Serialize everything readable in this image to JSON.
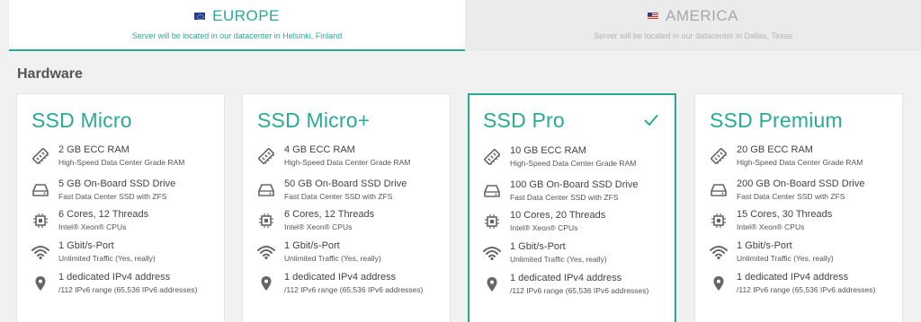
{
  "tabs": [
    {
      "region": "EUROPE",
      "subtitle": "Server will be located in our datacenter in Helsinki, Finland",
      "flag": "eu-flag-icon",
      "active": true
    },
    {
      "region": "AMERICA",
      "subtitle": "Server will be located in our datacenter in Dallas, Texas",
      "flag": "us-flag-icon",
      "active": false
    }
  ],
  "section": {
    "title": "Hardware"
  },
  "colors": {
    "accent": "#2aa996",
    "background": "#f1f1f1"
  },
  "plans": [
    {
      "name": "SSD Micro",
      "selected": false,
      "features": [
        {
          "icon": "ram-icon",
          "main": "2 GB ECC RAM",
          "sub": "High-Speed Data Center Grade RAM"
        },
        {
          "icon": "drive-icon",
          "main": "5 GB On-Board SSD Drive",
          "sub": "Fast Data Center SSD with ZFS"
        },
        {
          "icon": "cpu-icon",
          "main": "6 Cores, 12 Threads",
          "sub": "Intel® Xeon® CPUs"
        },
        {
          "icon": "wifi-icon",
          "main": "1 Gbit/s-Port",
          "sub": "Unlimited Traffic (Yes, really)"
        },
        {
          "icon": "location-pin-icon",
          "main": "1 dedicated IPv4 address",
          "sub": "/112 IPv6 range (65,536 IPv6 addresses)"
        }
      ]
    },
    {
      "name": "SSD Micro+",
      "selected": false,
      "features": [
        {
          "icon": "ram-icon",
          "main": "4 GB ECC RAM",
          "sub": "High-Speed Data Center Grade RAM"
        },
        {
          "icon": "drive-icon",
          "main": "50 GB On-Board SSD Drive",
          "sub": "Fast Data Center SSD with ZFS"
        },
        {
          "icon": "cpu-icon",
          "main": "6 Cores, 12 Threads",
          "sub": "Intel® Xeon® CPUs"
        },
        {
          "icon": "wifi-icon",
          "main": "1 Gbit/s-Port",
          "sub": "Unlimited Traffic (Yes, really)"
        },
        {
          "icon": "location-pin-icon",
          "main": "1 dedicated IPv4 address",
          "sub": "/112 IPv6 range (65,536 IPv6 addresses)"
        }
      ]
    },
    {
      "name": "SSD Pro",
      "selected": true,
      "features": [
        {
          "icon": "ram-icon",
          "main": "10 GB ECC RAM",
          "sub": "High-Speed Data Center Grade RAM"
        },
        {
          "icon": "drive-icon",
          "main": "100 GB On-Board SSD Drive",
          "sub": "Fast Data Center SSD with ZFS"
        },
        {
          "icon": "cpu-icon",
          "main": "10 Cores, 20 Threads",
          "sub": "Intel® Xeon® CPUs"
        },
        {
          "icon": "wifi-icon",
          "main": "1 Gbit/s-Port",
          "sub": "Unlimited Traffic (Yes, really)"
        },
        {
          "icon": "location-pin-icon",
          "main": "1 dedicated IPv4 address",
          "sub": "/112 IPv6 range (65,536 IPv6 addresses)"
        }
      ]
    },
    {
      "name": "SSD Premium",
      "selected": false,
      "features": [
        {
          "icon": "ram-icon",
          "main": "20 GB ECC RAM",
          "sub": "High-Speed Data Center Grade RAM"
        },
        {
          "icon": "drive-icon",
          "main": "200 GB On-Board SSD Drive",
          "sub": "Fast Data Center SSD with ZFS"
        },
        {
          "icon": "cpu-icon",
          "main": "15 Cores, 30 Threads",
          "sub": "Intel® Xeon® CPUs"
        },
        {
          "icon": "wifi-icon",
          "main": "1 Gbit/s-Port",
          "sub": "Unlimited Traffic (Yes, really)"
        },
        {
          "icon": "location-pin-icon",
          "main": "1 dedicated IPv4 address",
          "sub": "/112 IPv6 range (65,536 IPv6 addresses)"
        }
      ]
    }
  ]
}
